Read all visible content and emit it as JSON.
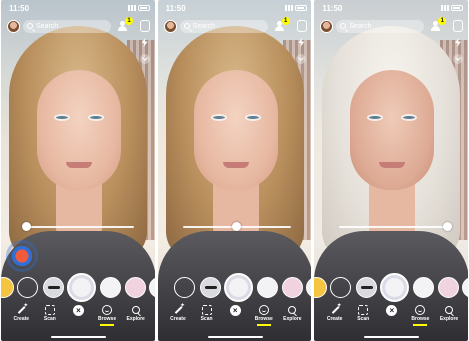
{
  "screens": [
    {
      "time": "11:50",
      "search_placeholder": "Search",
      "notification_count": "1",
      "nav": {
        "create": "Create",
        "scan": "Scan",
        "close": "×",
        "browse": "Browse",
        "explore": "Explore"
      },
      "age_slider_level": 0.0
    },
    {
      "time": "11:50",
      "search_placeholder": "Search",
      "notification_count": "1",
      "nav": {
        "create": "Create",
        "scan": "Scan",
        "close": "×",
        "browse": "Browse",
        "explore": "Explore"
      },
      "age_slider_level": 0.5
    },
    {
      "time": "11:50",
      "search_placeholder": "Search",
      "notification_count": "1",
      "nav": {
        "create": "Create",
        "scan": "Scan",
        "close": "×",
        "browse": "Browse",
        "explore": "Explore"
      },
      "age_slider_level": 1.0
    }
  ],
  "colors": {
    "accent": "#fffc00",
    "hair_young": "#b88e5c",
    "hair_old": "#e6e1da"
  }
}
